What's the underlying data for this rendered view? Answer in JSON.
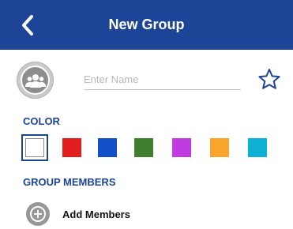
{
  "header": {
    "title": "New Group",
    "back_icon": "chevron-left-icon",
    "background_color": "#1c4497"
  },
  "group": {
    "avatar_icon": "group-avatar-icon",
    "name_placeholder": "Enter Name",
    "name_value": "",
    "favorite_icon": "star-outline-icon"
  },
  "color_section": {
    "label": "COLOR",
    "selected_index": 0,
    "swatches": [
      {
        "name": "white",
        "color": "#ffffff"
      },
      {
        "name": "red",
        "color": "#e11d1d"
      },
      {
        "name": "blue",
        "color": "#1250c8"
      },
      {
        "name": "green",
        "color": "#3f7f2f"
      },
      {
        "name": "purple",
        "color": "#c03be0"
      },
      {
        "name": "orange",
        "color": "#f8a52c"
      },
      {
        "name": "cyan",
        "color": "#0eb0d4"
      }
    ]
  },
  "members_section": {
    "label": "GROUP MEMBERS",
    "add_label": "Add Members",
    "add_icon": "add-circle-icon"
  }
}
